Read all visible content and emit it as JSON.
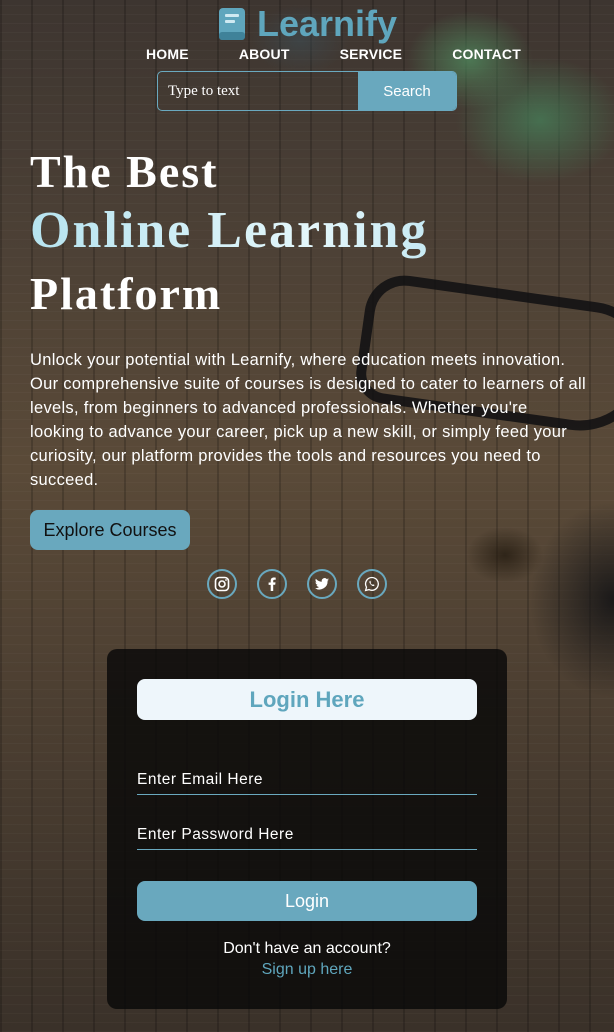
{
  "brand": {
    "name": "Learnify",
    "icon": "book-icon",
    "accent": "#69a8be"
  },
  "nav": {
    "items": [
      "HOME",
      "ABOUT",
      "SERVICE",
      "CONTACT"
    ]
  },
  "search": {
    "placeholder": "Type to text",
    "button_label": "Search"
  },
  "hero": {
    "line1": "The Best",
    "line2": "Online Learning",
    "line3": "Platform",
    "description": "Unlock your potential with Learnify, where education meets innovation. Our comprehensive suite of courses is designed to cater to learners of all levels, from beginners to advanced professionals. Whether you're looking to advance your career, pick up a new skill, or simply feed your curiosity, our platform provides the tools and resources you need to succeed.",
    "cta_label": "Explore Courses"
  },
  "social": {
    "icons": [
      "instagram-icon",
      "facebook-icon",
      "twitter-icon",
      "whatsapp-icon"
    ]
  },
  "login": {
    "title": "Login Here",
    "email_placeholder": "Enter Email Here",
    "password_placeholder": "Enter Password Here",
    "button_label": "Login",
    "signup_question": "Don't have an account?",
    "signup_link": "Sign up here"
  }
}
